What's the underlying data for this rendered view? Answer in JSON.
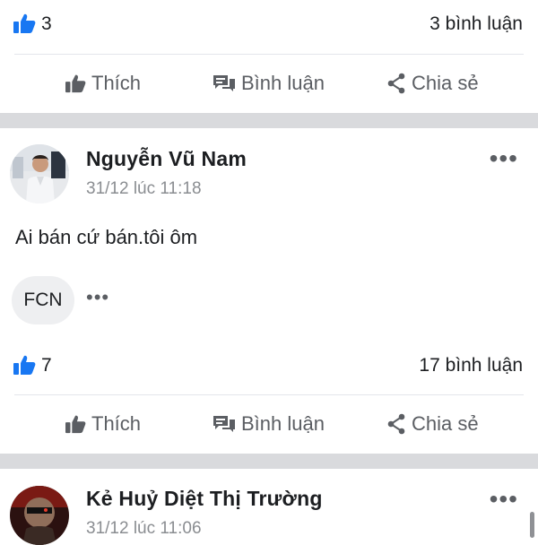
{
  "post1": {
    "likes": "3",
    "comments": "3 bình luận",
    "actions": {
      "like": "Thích",
      "comment": "Bình luận",
      "share": "Chia sẻ"
    }
  },
  "post2": {
    "author": "Nguyễn Vũ Nam",
    "time": "31/12 lúc 11:18",
    "text": "Ai bán cứ bán.tôi ôm",
    "chip": "FCN",
    "more": "•••",
    "likes": "7",
    "comments": "17 bình luận",
    "actions": {
      "like": "Thích",
      "comment": "Bình luận",
      "share": "Chia sẻ"
    }
  },
  "post3": {
    "author": "Kẻ Huỷ Diệt Thị Trường",
    "time": "31/12 lúc 11:06",
    "more": "•••"
  },
  "colors": {
    "accent": "#1877f2",
    "muted": "#5b5e63",
    "separator": "#d9dadd"
  }
}
